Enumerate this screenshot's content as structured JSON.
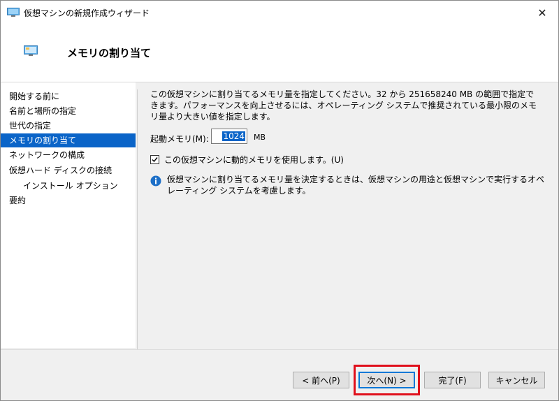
{
  "window": {
    "title": "仮想マシンの新規作成ウィザード",
    "close_glyph": "✕"
  },
  "header": {
    "title": "メモリの割り当て"
  },
  "nav": {
    "items": [
      {
        "label": "開始する前に"
      },
      {
        "label": "名前と場所の指定"
      },
      {
        "label": "世代の指定"
      },
      {
        "label": "メモリの割り当て",
        "selected": true
      },
      {
        "label": "ネットワークの構成"
      },
      {
        "label": "仮想ハード ディスクの接続"
      },
      {
        "label": "インストール オプション",
        "indent": true
      },
      {
        "label": "要約"
      }
    ]
  },
  "main": {
    "description": "この仮想マシンに割り当てるメモリ量を指定してください。32 から 251658240 MB の範囲で指定できます。パフォーマンスを向上させるには、オペレーティング システムで推奨されている最小限のメモリ量より大きい値を指定します。",
    "startup_memory_label": "起動メモリ(M):",
    "startup_memory_value": "1024",
    "startup_memory_unit": "MB",
    "dynamic_memory_label": "この仮想マシンに動的メモリを使用します。(U)",
    "dynamic_memory_checked": true,
    "info_text": "仮想マシンに割り当てるメモリ量を決定するときは、仮想マシンの用途と仮想マシンで実行するオペレーティング システムを考慮します。"
  },
  "footer": {
    "prev_label": "< 前へ(P)",
    "next_label": "次へ(N) >",
    "finish_label": "完了(F)",
    "cancel_label": "キャンセル"
  },
  "colors": {
    "selection": "#0a64c8",
    "highlight_border": "#e0101c",
    "info_icon": "#1d6fc7"
  },
  "icons": {
    "app": "monitor-icon",
    "info": "info-icon",
    "close": "close-icon"
  }
}
